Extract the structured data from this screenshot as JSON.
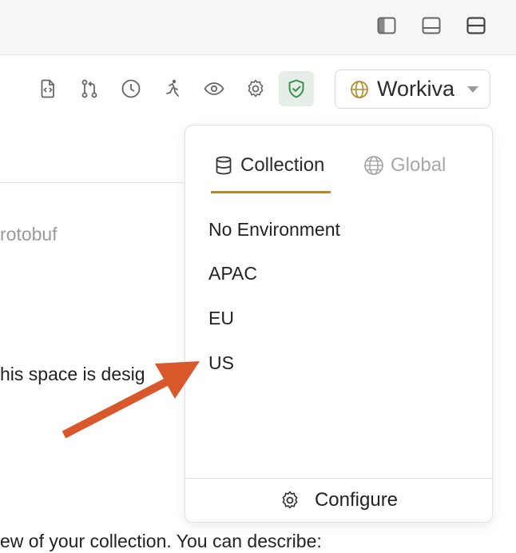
{
  "window_controls": [
    {
      "name": "toggle-sidebar-icon"
    },
    {
      "name": "toggle-bottom-panel-icon"
    },
    {
      "name": "toggle-split-layout-icon"
    }
  ],
  "toolbar": {
    "icons": [
      "file-code-icon",
      "git-branch-icon",
      "history-icon",
      "runner-icon",
      "eye-icon",
      "gear-icon",
      "shield-check-icon"
    ],
    "environment_selector": {
      "label": "Workiva"
    }
  },
  "background": {
    "protobuf_text": "rotobuf",
    "space_text": "his space is desig",
    "collection_text": "ew of your collection. You can describe:"
  },
  "env_panel": {
    "tabs": [
      {
        "label": "Collection",
        "active": true
      },
      {
        "label": "Global",
        "active": false
      }
    ],
    "items": [
      "No Environment",
      "APAC",
      "EU",
      "US"
    ],
    "footer_label": "Configure"
  },
  "colors": {
    "accent_underline": "#b58a2e",
    "active_icon_bg": "#e6efe7",
    "shield_green": "#3f8f4e",
    "arrow": "#d9582b"
  }
}
